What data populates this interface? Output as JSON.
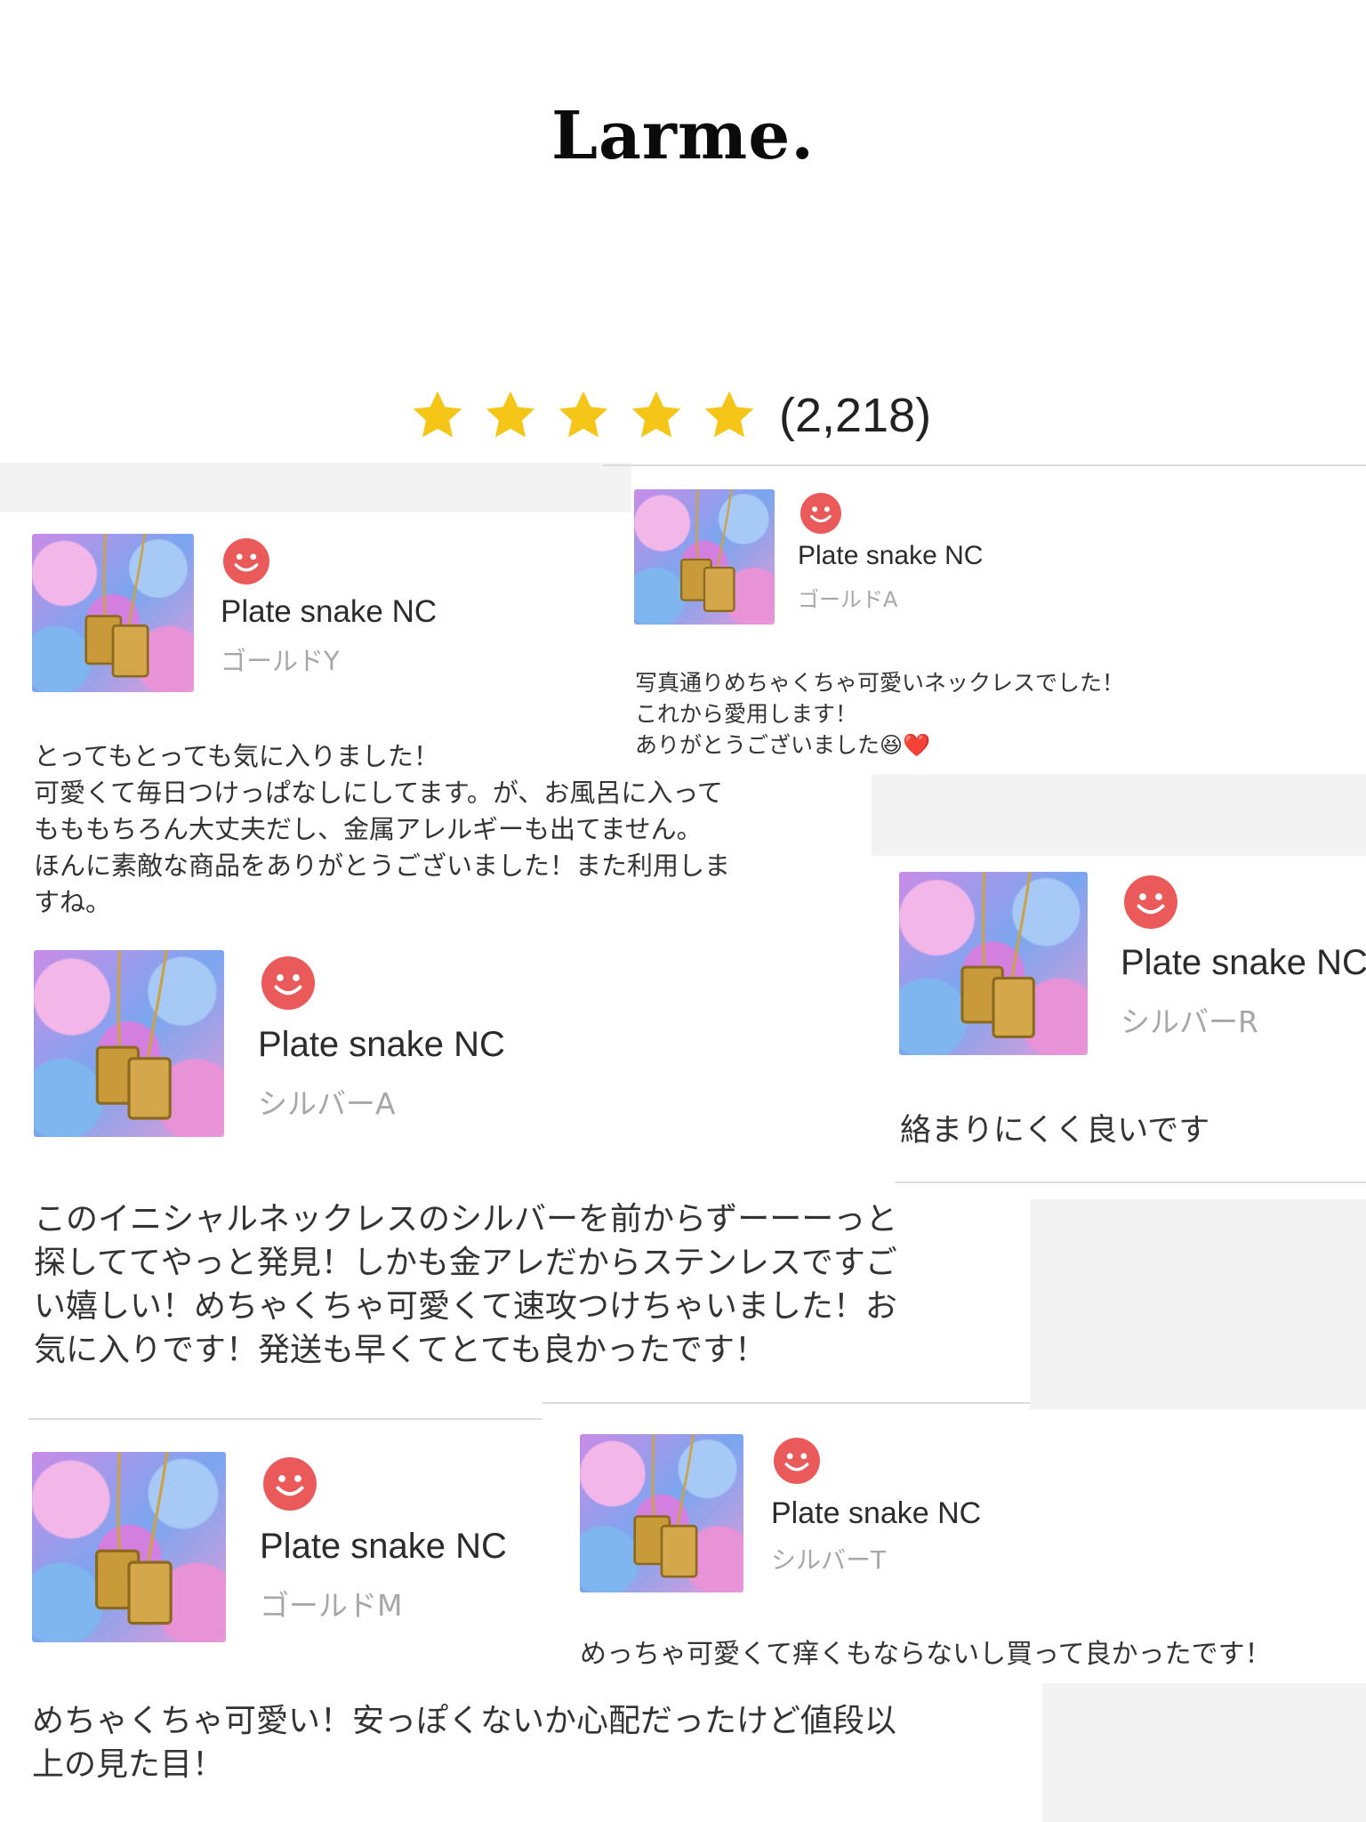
{
  "brand": {
    "logo_text": "Larme."
  },
  "rating": {
    "stars": 5,
    "max_stars": 5,
    "count_text": "(2,218)",
    "star_color": "#f5c518"
  },
  "colors": {
    "smile": "#ea5a5a",
    "variant_text": "#a7a7a7"
  },
  "reviews": [
    {
      "product": "Plate snake NC",
      "variant": "ゴールドY",
      "text": "とってもとっても気に入りました！\n可愛くて毎日つけっぱなしにしてます。が、お風呂に入って\nもももちろん大丈夫だし、金属アレルギーも出てません。\nほんに素敵な商品をありがとうございました！また利用しま\nすね。"
    },
    {
      "product": "Plate snake NC",
      "variant": "ゴールドA",
      "text": "写真通りめちゃくちゃ可愛いネックレスでした！\nこれから愛用します！\nありがとうございました😆❤️"
    },
    {
      "product": "Plate snake NC",
      "variant": "シルバーR",
      "text": "絡まりにくく良いです"
    },
    {
      "product": "Plate snake NC",
      "variant": "シルバーA",
      "text": "このイニシャルネックレスのシルバーを前からずーーーっと\n探しててやっと発見！しかも金アレだからステンレスですご\nい嬉しい！めちゃくちゃ可愛くて速攻つけちゃいました！お\n気に入りです！発送も早くてとても良かったです！"
    },
    {
      "product": "Plate snake NC",
      "variant": "ゴールドM",
      "text": "めちゃくちゃ可愛い！安っぽくないか心配だったけど値段以\n上の見た目！"
    },
    {
      "product": "Plate snake NC",
      "variant": "シルバーT",
      "text": "めっちゃ可愛くて痒くもならないし買って良かったです！"
    }
  ]
}
